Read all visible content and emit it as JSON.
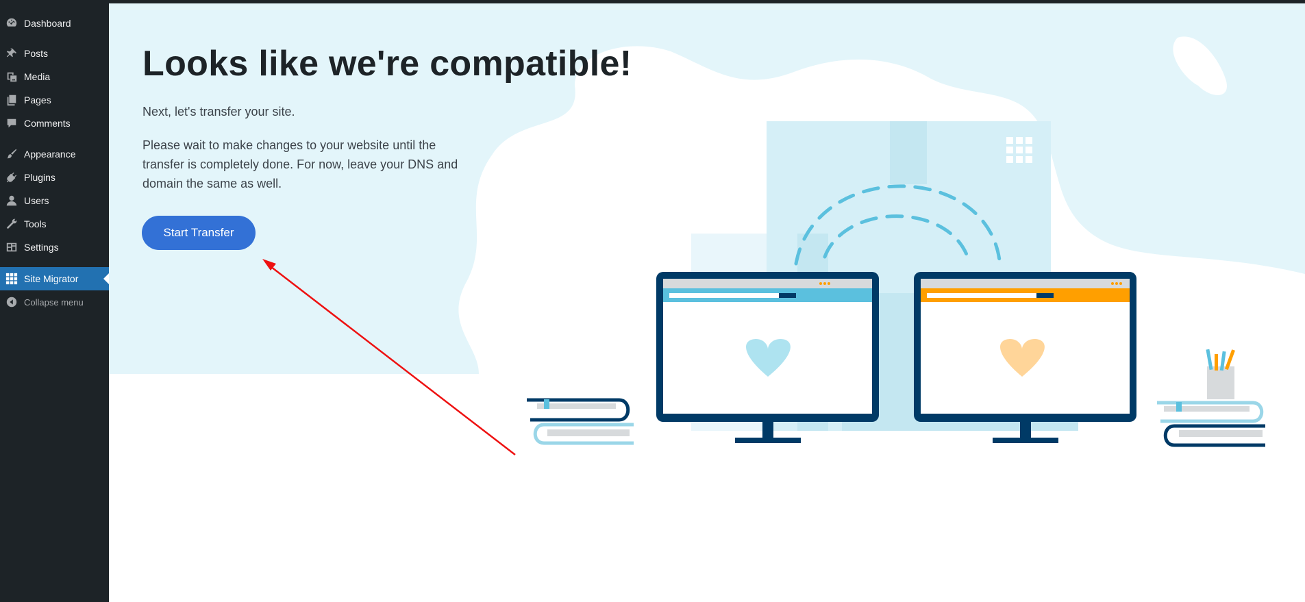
{
  "sidebar": {
    "items": [
      {
        "label": "Dashboard",
        "icon": "dashboard-icon"
      },
      {
        "label": "Posts",
        "icon": "pin-icon"
      },
      {
        "label": "Media",
        "icon": "media-icon"
      },
      {
        "label": "Pages",
        "icon": "pages-icon"
      },
      {
        "label": "Comments",
        "icon": "comment-icon"
      },
      {
        "label": "Appearance",
        "icon": "brush-icon"
      },
      {
        "label": "Plugins",
        "icon": "plugin-icon"
      },
      {
        "label": "Users",
        "icon": "user-icon"
      },
      {
        "label": "Tools",
        "icon": "wrench-icon"
      },
      {
        "label": "Settings",
        "icon": "settings-icon"
      },
      {
        "label": "Site Migrator",
        "icon": "grid-icon"
      },
      {
        "label": "Collapse menu",
        "icon": "collapse-icon"
      }
    ],
    "active": "Site Migrator"
  },
  "main": {
    "title": "Looks like we're compatible!",
    "subtitle": "Next, let's transfer your site.",
    "paragraph": "Please wait to make changes to your website until the transfer is completely done. For now, leave your DNS and domain the same as well.",
    "button_label": "Start Transfer"
  },
  "colors": {
    "sidebar_bg": "#1d2327",
    "active_bg": "#2271b1",
    "hero_bg": "#e3f5fa",
    "button_bg": "#3371d6",
    "monitor_frame": "#003a66",
    "accent_blue": "#5bc0de",
    "accent_orange": "#ff9f00",
    "annotation_arrow": "#ee1111"
  }
}
